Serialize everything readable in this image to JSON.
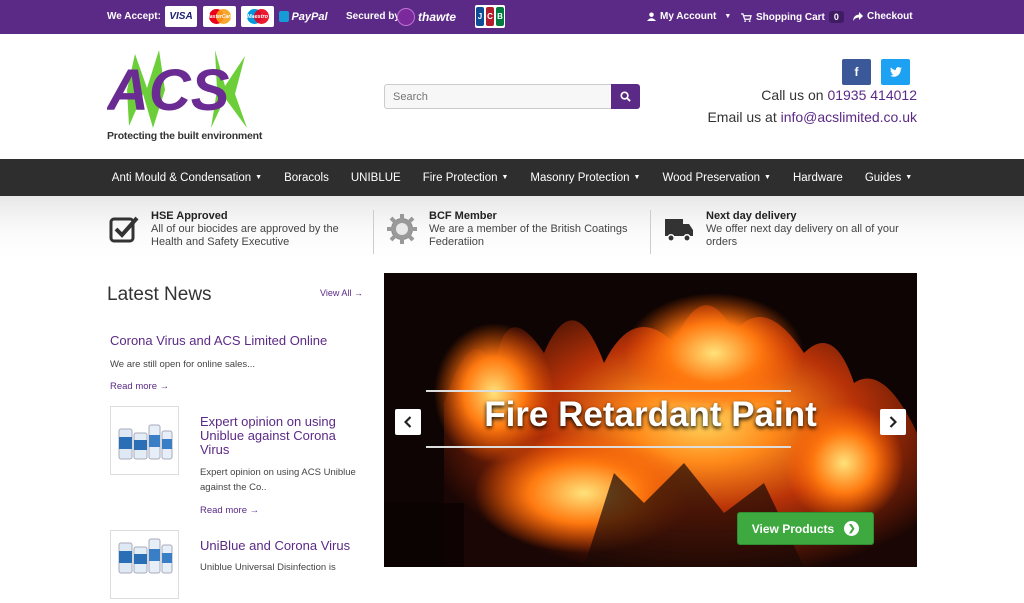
{
  "topbar": {
    "accept_label": "We Accept:",
    "cards": [
      "VISA",
      "MasterCard",
      "Maestro",
      "PayPal"
    ],
    "secured_label": "Secured by:",
    "thawte": "thawte",
    "jcb": [
      "J",
      "C",
      "B"
    ],
    "my_account": "My Account",
    "shopping_cart": "Shopping Cart",
    "cart_count": "0",
    "checkout": "Checkout"
  },
  "header": {
    "logo_text": "ACS",
    "tagline": "Protecting the built environment",
    "search_placeholder": "Search",
    "facebook": "f",
    "twitter": "t",
    "call_label": "Call us on",
    "phone": "01935 414012",
    "email_label": "Email us at",
    "email": "info@acslimited.co.uk"
  },
  "nav": {
    "items": [
      "Anti Mould & Condensation",
      "Boracols",
      "UNIBLUE",
      "Fire Protection",
      "Masonry Protection",
      "Wood Preservation",
      "Hardware",
      "Guides"
    ]
  },
  "features": [
    {
      "title": "HSE Approved",
      "desc": "All of our biocides are approved by the Health and Safety Executive"
    },
    {
      "title": "BCF Member",
      "desc": "We are a member of the British Coatings Federatiion"
    },
    {
      "title": "Next day delivery",
      "desc": "We offer next day delivery on all of your orders"
    }
  ],
  "news": {
    "title": "Latest News",
    "view_all": "View All",
    "articles": [
      {
        "title": "Corona Virus and ACS Limited Online",
        "text": "We are still open for online sales...",
        "read_more": "Read more"
      },
      {
        "title": "Expert opinion on using Uniblue against Corona Virus",
        "text": "Expert opinion on using ACS Uniblue against the Co..",
        "read_more": "Read more"
      },
      {
        "title": "UniBlue and Corona Virus",
        "text": "Uniblue Universal Disinfection is"
      }
    ]
  },
  "slider": {
    "headline": "Fire Retardant Paint",
    "button": "View Products"
  },
  "colors": {
    "brand_purple": "#5b2a86",
    "nav_dark": "#2e2e2e",
    "cta_green": "#3ea93f"
  }
}
